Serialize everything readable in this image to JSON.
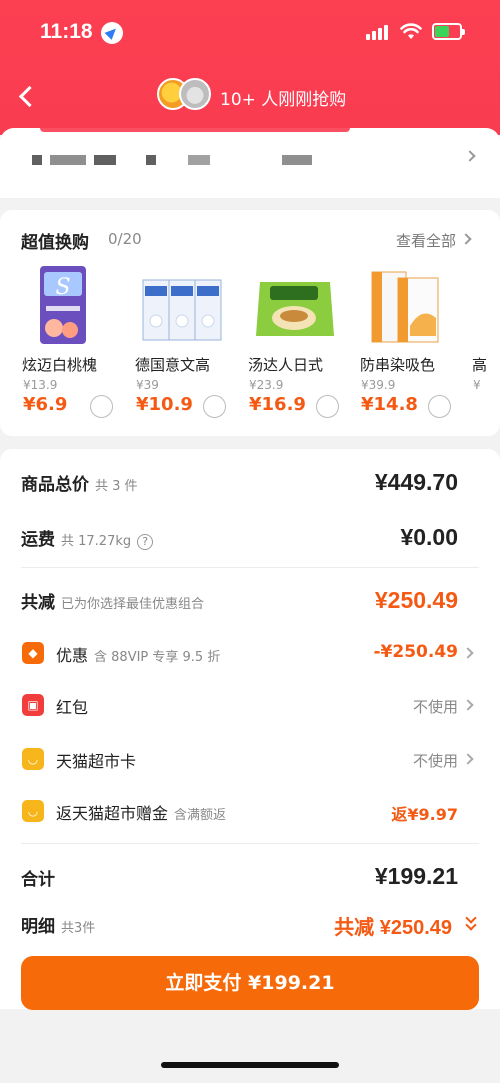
{
  "status_bar": {
    "time": "11:18"
  },
  "nav": {
    "title": "10+ 人刚刚抢购"
  },
  "swap": {
    "title": "超值换购",
    "count": "0/20",
    "view_all": "查看全部",
    "products": [
      {
        "name": "炫迈白桃槐",
        "old_price": "¥13.9",
        "new_price": "¥6.9"
      },
      {
        "name": "德国意文高",
        "old_price": "¥39",
        "new_price": "¥10.9"
      },
      {
        "name": "汤达人日式",
        "old_price": "¥23.9",
        "new_price": "¥16.9"
      },
      {
        "name": "防串染吸色",
        "old_price": "¥39.9",
        "new_price": "¥14.8"
      },
      {
        "name": "高",
        "old_price": "¥",
        "new_price": ""
      }
    ]
  },
  "summary": {
    "goods_total": {
      "label": "商品总价",
      "sub": "共 3 件",
      "amount": "¥449.70"
    },
    "shipping": {
      "label": "运费",
      "sub": "共 17.27kg",
      "amount": "¥0.00"
    },
    "discount": {
      "label": "共减",
      "sub": "已为你选择最佳优惠组合",
      "amount": "¥250.49"
    },
    "coupon": {
      "label": "优惠",
      "sub": "含 88VIP 专享 9.5 折",
      "amount": "-¥250.49"
    },
    "red_packet": {
      "label": "红包",
      "value": "不使用"
    },
    "supermarket_card": {
      "label": "天猫超市卡",
      "value": "不使用"
    },
    "cashback": {
      "label": "返天猫超市赠金",
      "sub": "含满额返",
      "value": "返¥9.97"
    },
    "total": {
      "label": "合计",
      "amount": "¥199.21"
    },
    "detail": {
      "label": "明细",
      "sub": "共3件",
      "value": "共减 ¥250.49"
    }
  },
  "pay_button": "立即支付 ¥199.21",
  "colors": {
    "header": "#f93c50",
    "accent": "#f45a13",
    "pay": "#f66a09"
  }
}
